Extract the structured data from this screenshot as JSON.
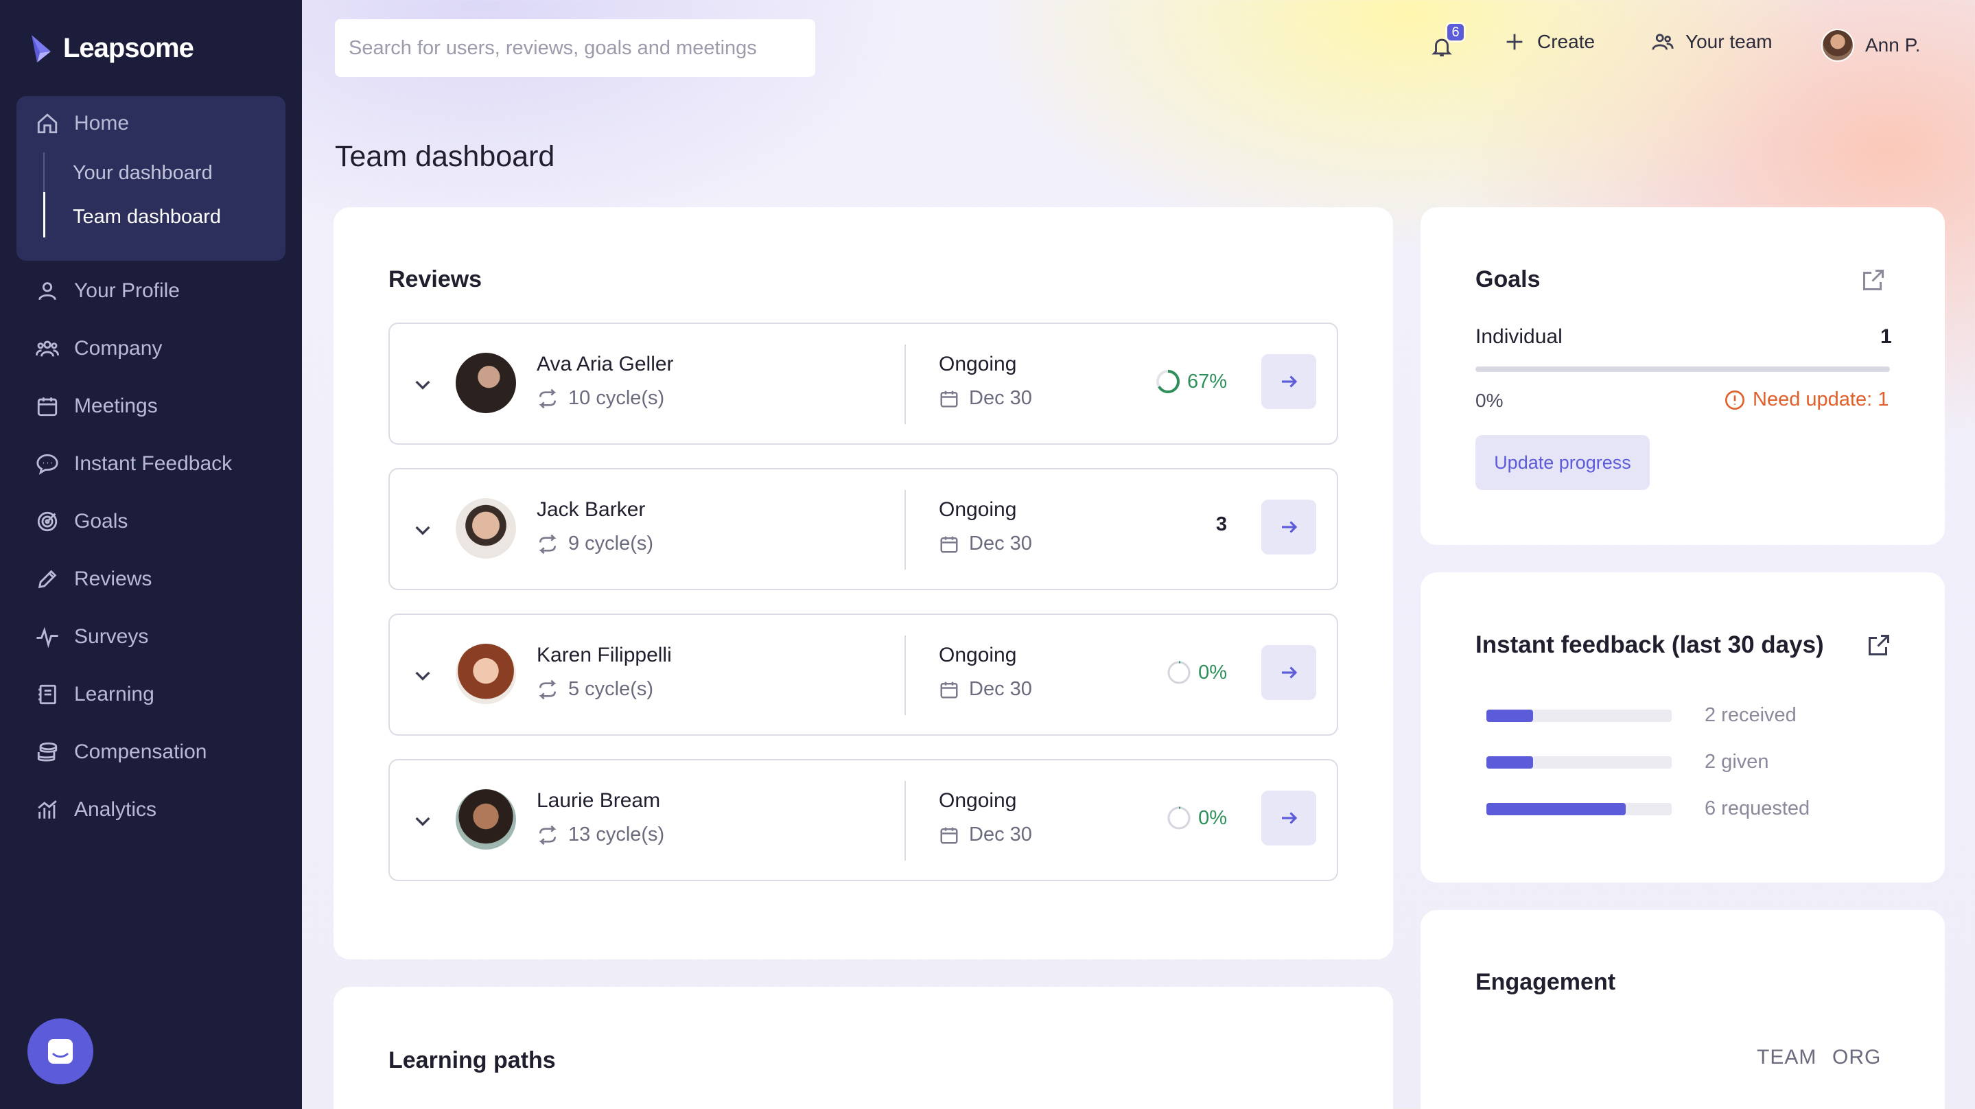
{
  "app": {
    "name": "Leapsome"
  },
  "sidebar": {
    "home": {
      "label": "Home",
      "sub": [
        {
          "label": "Your dashboard"
        },
        {
          "label": "Team dashboard"
        }
      ]
    },
    "items": [
      {
        "label": "Your Profile",
        "icon": "user-icon"
      },
      {
        "label": "Company",
        "icon": "people-icon"
      },
      {
        "label": "Meetings",
        "icon": "calendar-icon"
      },
      {
        "label": "Instant Feedback",
        "icon": "chat-icon"
      },
      {
        "label": "Goals",
        "icon": "target-icon"
      },
      {
        "label": "Reviews",
        "icon": "pencil-icon"
      },
      {
        "label": "Surveys",
        "icon": "pulse-icon"
      },
      {
        "label": "Learning",
        "icon": "book-icon"
      },
      {
        "label": "Compensation",
        "icon": "coins-icon"
      },
      {
        "label": "Analytics",
        "icon": "bar-chart-icon"
      }
    ]
  },
  "topbar": {
    "search_placeholder": "Search for users, reviews, goals and meetings",
    "notifications_count": "6",
    "create_label": "Create",
    "your_team_label": "Your team",
    "user_name": "Ann P."
  },
  "page": {
    "title": "Team dashboard"
  },
  "reviews": {
    "title": "Reviews",
    "rows": [
      {
        "name": "Ava Aria Geller",
        "cycles": "10 cycle(s)",
        "status": "Ongoing",
        "due": "Dec 30",
        "progress": "67%",
        "progress_fraction": 0.67,
        "progress_color": "#2f8f5b"
      },
      {
        "name": "Jack Barker",
        "cycles": "9 cycle(s)",
        "status": "Ongoing",
        "due": "Dec 30",
        "progress": "3",
        "progress_fraction": null,
        "progress_color": "#1f1f2e"
      },
      {
        "name": "Karen Filippelli",
        "cycles": "5 cycle(s)",
        "status": "Ongoing",
        "due": "Dec 30",
        "progress": "0%",
        "progress_fraction": 0,
        "progress_color": "#2f8f5b"
      },
      {
        "name": "Laurie Bream",
        "cycles": "13 cycle(s)",
        "status": "Ongoing",
        "due": "Dec 30",
        "progress": "0%",
        "progress_fraction": 0,
        "progress_color": "#2f8f5b"
      }
    ]
  },
  "learning": {
    "title": "Learning paths"
  },
  "goals": {
    "title": "Goals",
    "individual_label": "Individual",
    "individual_count": "1",
    "progress_label": "0%",
    "progress_fraction": 0,
    "need_update": "Need update: 1",
    "update_button": "Update progress",
    "warning_color": "#e0602b"
  },
  "feedback": {
    "title": "Instant feedback (last 30 days)",
    "rows": [
      {
        "label": "2 received",
        "fraction": 0.25
      },
      {
        "label": "2 given",
        "fraction": 0.25
      },
      {
        "label": "6 requested",
        "fraction": 0.75
      }
    ]
  },
  "engagement": {
    "title": "Engagement",
    "tabs": [
      "TEAM",
      "ORG"
    ]
  },
  "colors": {
    "accent": "#5c5bd9",
    "sidebar": "#1c1d3a",
    "success": "#2f8f5b"
  }
}
